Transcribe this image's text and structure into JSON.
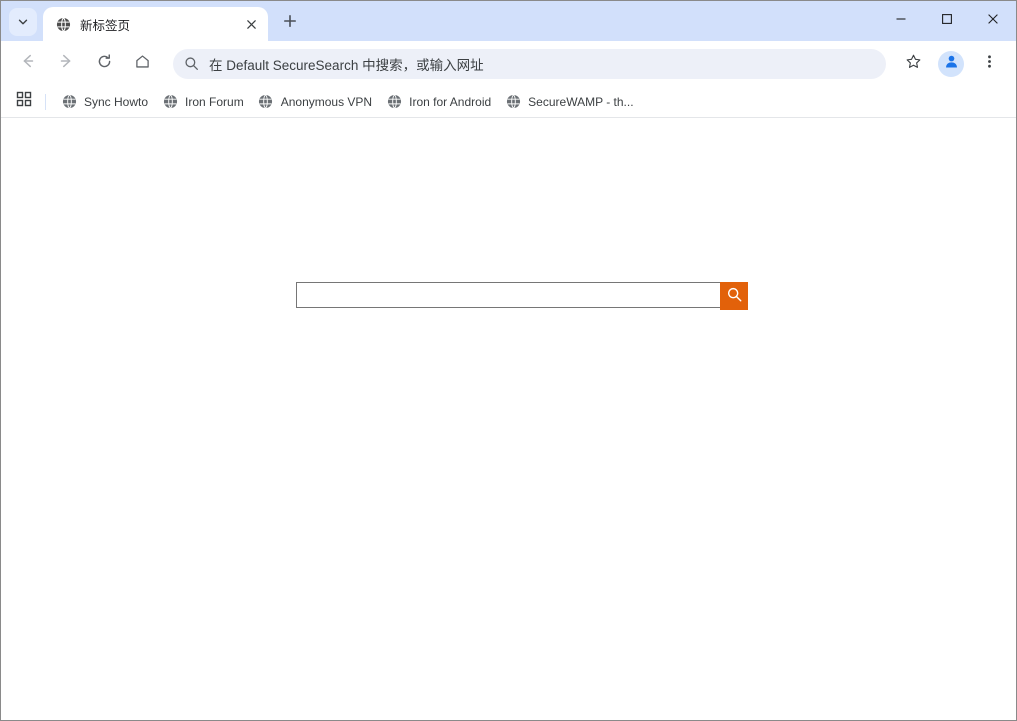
{
  "window": {
    "controls": {
      "minimize": "minimize-icon",
      "maximize": "maximize-icon",
      "close": "close-icon"
    }
  },
  "tabstrip": {
    "tab_search_icon": "chevron-down-icon",
    "new_tab_icon": "plus-icon",
    "tabs": [
      {
        "title": "新标签页",
        "favicon": "globe-icon",
        "close_icon": "close-icon",
        "active": true
      }
    ]
  },
  "toolbar": {
    "back_icon": "arrow-left-icon",
    "forward_icon": "arrow-right-icon",
    "reload_icon": "reload-icon",
    "home_icon": "home-icon",
    "bookmark_star_icon": "star-icon",
    "profile_icon": "avatar-icon",
    "menu_icon": "three-dots-icon",
    "omnibox": {
      "search_icon": "search-icon",
      "value": "",
      "placeholder": "在 Default SecureSearch 中搜索，或输入网址"
    }
  },
  "bookmarks_bar": {
    "apps_icon": "apps-grid-icon",
    "items": [
      {
        "label": "Sync Howto",
        "favicon": "globe-icon"
      },
      {
        "label": "Iron Forum",
        "favicon": "globe-icon"
      },
      {
        "label": "Anonymous VPN",
        "favicon": "globe-icon"
      },
      {
        "label": "Iron for Android",
        "favicon": "globe-icon"
      },
      {
        "label": "SecureWAMP - th...",
        "favicon": "globe-icon"
      }
    ]
  },
  "page": {
    "search": {
      "value": "",
      "placeholder": "",
      "button_icon": "search-icon",
      "button_color": "#e2610a"
    }
  },
  "colors": {
    "tabstrip_bg": "#d2e0fb",
    "toolbar_bg": "#ffffff",
    "omnibox_bg": "#edf0f8",
    "accent_orange": "#e2610a",
    "profile_blue": "#1a73e8"
  }
}
